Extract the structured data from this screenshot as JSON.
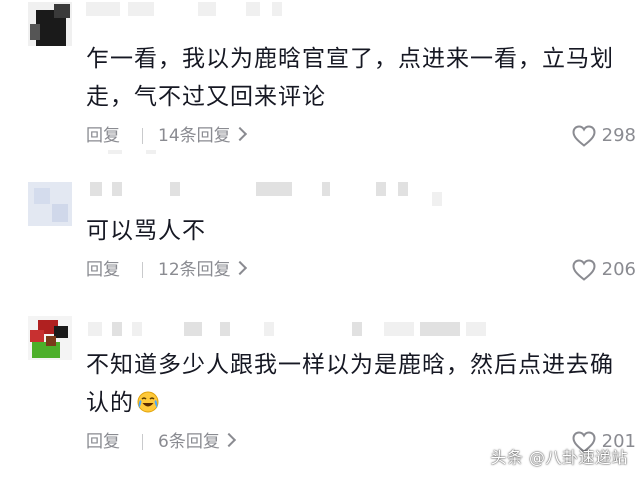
{
  "comments": [
    {
      "text": "乍一看，我以为鹿晗官宣了，点进来一看，立马划走，气不过又回来评论",
      "reply_label": "回复",
      "replies_label": "14条回复",
      "likes": "298"
    },
    {
      "text": "可以骂人不",
      "reply_label": "回复",
      "replies_label": "12条回复",
      "likes": "206"
    },
    {
      "text": "不知道多少人跟我一样以为是鹿晗，然后点进去确认的",
      "reply_label": "回复",
      "replies_label": "6条回复",
      "likes": "201"
    }
  ],
  "watermark": "头条 @八卦速递站",
  "colors": {
    "text": "#161823",
    "muted": "#8a8b91"
  },
  "icons": {
    "like": "heart-outline-icon",
    "more": "chevron-right-icon",
    "emoji": "crying-laughing-emoji-icon"
  }
}
